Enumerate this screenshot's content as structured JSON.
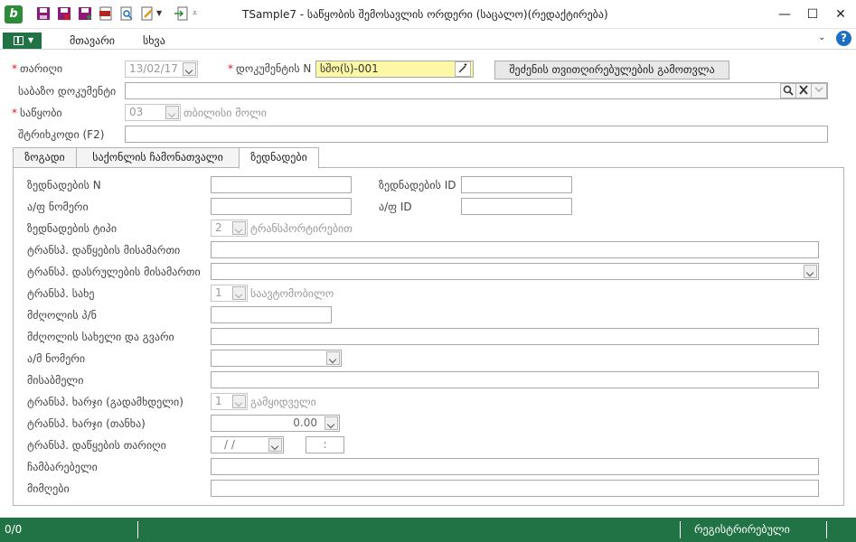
{
  "window": {
    "title": "TSample7 - საწყობის შემოსავლის ორდერი (საცალო)(რედაქტირება)",
    "app_logo": "b",
    "minimize": "—",
    "maximize": "☐",
    "close": "✕"
  },
  "ribbon": {
    "tabs": [
      "მთავარი",
      "სხვა"
    ],
    "help": "?",
    "collapse": "⌄"
  },
  "form": {
    "date_label": "თარიღი",
    "date_value": "13/02/17",
    "docnum_label": "დოკუმენტის N",
    "docnum_value": "სშო(ს)-001",
    "calc_button": "შეძენის თვითღირებულების გამოთვლა",
    "base_doc_label": "საბაზო დოკუმენტი",
    "base_doc_value": "",
    "warehouse_label": "საწყობი",
    "warehouse_code": "03",
    "warehouse_name": "თბილისი მოლი",
    "barcode_label": "შტრიხკოდი (F2)",
    "barcode_value": ""
  },
  "tabs": [
    "ზოგადი",
    "საქონლის ჩამონათვალი",
    "ზედნადები"
  ],
  "waybill": {
    "number_label": "ზედნადების N",
    "id_label": "ზედნადების ID",
    "invoice_label": "ა/ფ ნომერი",
    "invoice_id_label": "ა/ფ ID",
    "type_label": "ზედნადების ტიპი",
    "type_code": "2",
    "type_name": "ტრანსპორტირებით",
    "start_addr_label": "ტრანსპ. დაწყების მისამართი",
    "end_addr_label": "ტრანსპ. დასრულების მისამართი",
    "transport_label": "ტრანსპ. სახე",
    "transport_code": "1",
    "transport_name": "საავტომობილო",
    "driver_pn_label": "მძღოლის პ/ნ",
    "driver_name_label": "მძღოლის სახელი და გვარი",
    "car_number_label": "ა/მ ნომერი",
    "receiver_label": "მისაბმელი",
    "cost_payer_label": "ტრანსპ. ხარჯი (გადამხდელი)",
    "cost_payer_code": "1",
    "cost_payer_name": "გამყიდველი",
    "cost_amount_label": "ტრანსპ. ხარჯი (თანხა)",
    "cost_amount_value": "0.00",
    "start_date_label": "ტრანსპ. დაწყების თარიღი",
    "start_date_value": "/  /",
    "start_time_value": ":",
    "deliverer_label": "ჩამბარებელი",
    "recipient_label": "მიმღები"
  },
  "status": {
    "count": "0/0",
    "registered": "რეგისტრირებული"
  }
}
